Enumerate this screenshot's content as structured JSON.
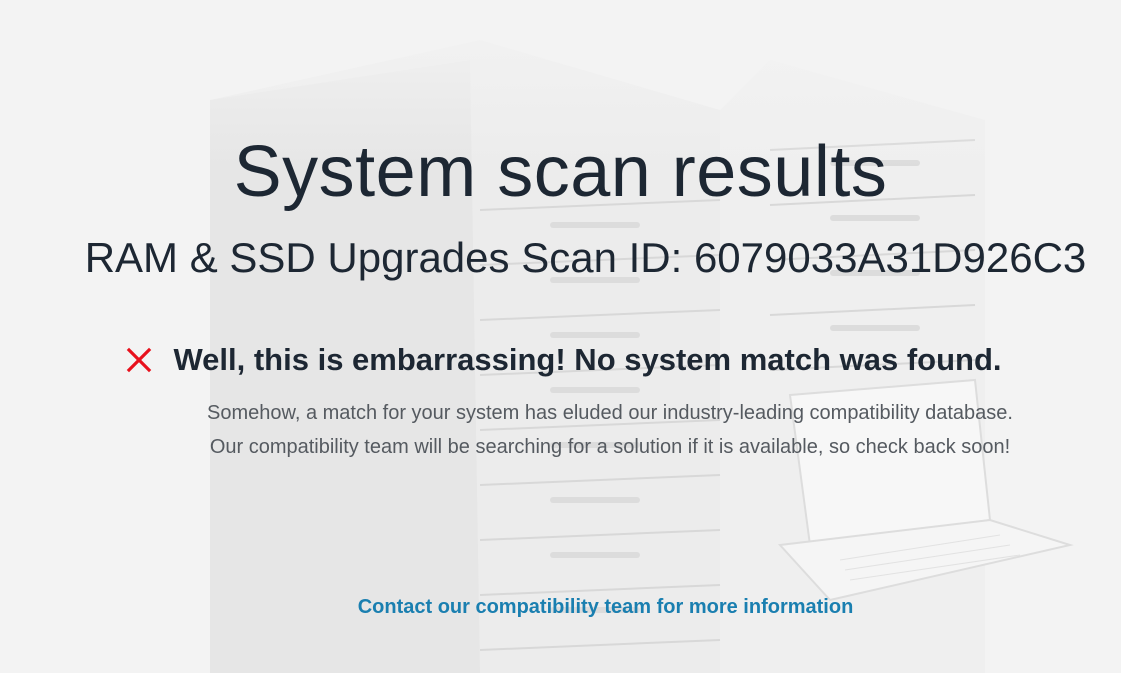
{
  "page": {
    "title": "System scan results",
    "subtitle_prefix": "RAM & SSD Upgrades Scan ID: ",
    "scan_id": "6079033A31D926C3"
  },
  "result": {
    "status_icon": "close-x-icon",
    "status_color": "#e8101c",
    "heading": "Well, this is embarrassing! No system match was found.",
    "description": "Somehow, a match for your system has eluded our industry-leading compatibility database. Our compatibility team will be searching for a solution if it is available, so check back soon!"
  },
  "contact": {
    "link_label": "Contact our compatibility team for more information",
    "link_color": "#1a7fb0"
  },
  "colors": {
    "background": "#f3f3f3",
    "text_dark": "#1d2733",
    "text_muted": "#555a60"
  }
}
